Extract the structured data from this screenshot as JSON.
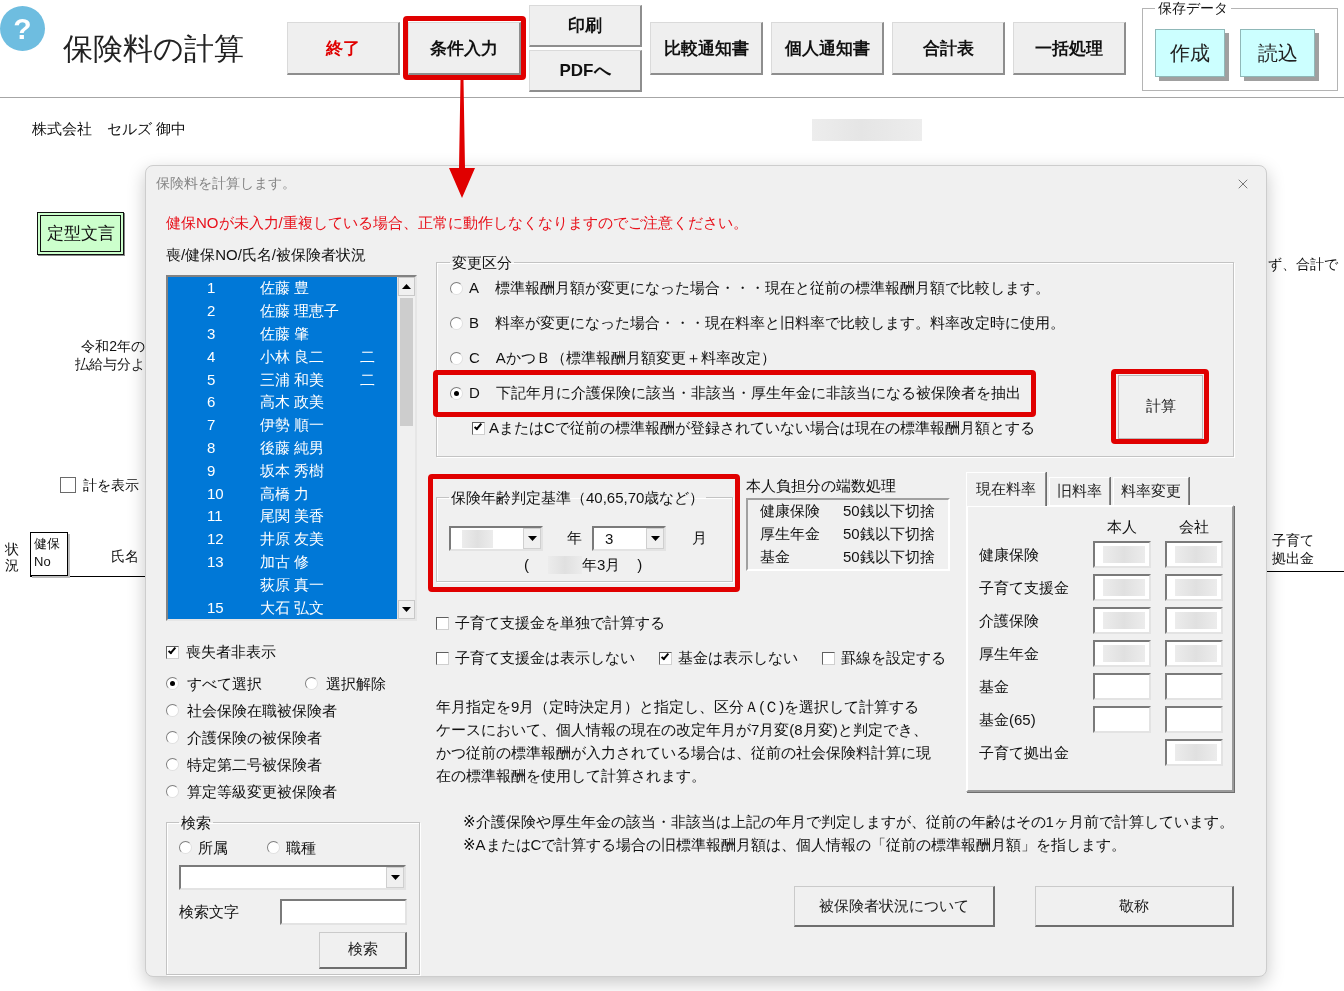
{
  "toolbar": {
    "help": "?",
    "title": "保険料の計算",
    "items": [
      {
        "kind": "exit",
        "label": "終了",
        "highlighted": false
      },
      {
        "kind": "command",
        "label": "条件入力",
        "highlighted": true
      },
      {
        "kind": "stack",
        "buttons": [
          {
            "label": "印刷"
          },
          {
            "label": "PDFへ"
          }
        ]
      },
      {
        "kind": "command",
        "label": "比較通知書",
        "highlighted": false
      },
      {
        "kind": "command",
        "label": "個人通知書",
        "highlighted": false
      },
      {
        "kind": "command",
        "label": "合計表",
        "highlighted": false
      },
      {
        "kind": "command",
        "label": "一括処理",
        "highlighted": false
      }
    ],
    "save_data": {
      "title": "保存データ",
      "buttons": [
        "作成",
        "読込"
      ]
    }
  },
  "sheet": {
    "addressee": "株式会社　セルズ 御中",
    "template_button": "定型文言",
    "memo_lines": [
      "令和2年の",
      "払給与分よ"
    ],
    "show_total": {
      "label": "計を表示",
      "checked": false
    },
    "header": {
      "status": "状況",
      "number": "健保No",
      "name": "氏名"
    },
    "right_text": "ず、合計で",
    "right_header": "子育て拠出金"
  },
  "dialog": {
    "title": "保険料を計算します。",
    "warning": "健保NOが未入力/重複している場合、正常に動作しなくなりますのでご注意ください。",
    "list_label": "喪/健保NO/氏名/被保険者状況",
    "insured_list": [
      {
        "number": "1",
        "name": "佐藤 豊",
        "selected": true
      },
      {
        "number": "2",
        "name": "佐藤 理恵子",
        "selected": true
      },
      {
        "number": "3",
        "name": "佐藤 肇",
        "selected": true
      },
      {
        "number": "4",
        "name": "小林 良二",
        "status": "二",
        "selected": true
      },
      {
        "number": "5",
        "name": "三浦 和美",
        "status": "二",
        "selected": true
      },
      {
        "number": "6",
        "name": "高木 政美",
        "selected": true
      },
      {
        "number": "7",
        "name": "伊勢 順一",
        "selected": true
      },
      {
        "number": "8",
        "name": "後藤 純男",
        "selected": true
      },
      {
        "number": "9",
        "name": "坂本 秀樹",
        "selected": true
      },
      {
        "number": "10",
        "name": "高橋 力",
        "selected": true
      },
      {
        "number": "11",
        "name": "尾関 美香",
        "selected": true
      },
      {
        "number": "12",
        "name": "井原 友美",
        "selected": true
      },
      {
        "number": "13",
        "name": "加古 修",
        "selected": true
      },
      {
        "name": "荻原 真一",
        "selected": true
      },
      {
        "number": "15",
        "name": "大石 弘文",
        "selected": true
      }
    ],
    "hide_lost": {
      "label": "喪失者非表示",
      "checked": true
    },
    "filters": [
      {
        "label": "すべて選択",
        "selected": true
      },
      {
        "label": "選択解除",
        "selected": false
      },
      {
        "label": "社会保険在職被保険者",
        "selected": false
      },
      {
        "label": "介護保険の被保険者",
        "selected": false
      },
      {
        "label": "特定第二号被保険者",
        "selected": false
      },
      {
        "label": "算定等級変更被保険者",
        "selected": false
      }
    ],
    "search": {
      "title": "検索",
      "scopes": [
        {
          "label": "所属",
          "selected": false
        },
        {
          "label": "職種",
          "selected": false
        }
      ],
      "keyword_label": "検索文字",
      "button": "検索"
    },
    "change_type": {
      "title": "変更区分",
      "options": [
        {
          "letter": "A",
          "text": "標準報酬月額が変更になった場合・・・現在と従前の標準報酬月額で比較します。",
          "selected": false,
          "highlighted": false
        },
        {
          "letter": "B",
          "text": "料率が変更になった場合・・・現在料率と旧料率で比較します。料率改定時に使用。",
          "selected": false,
          "highlighted": false
        },
        {
          "letter": "C",
          "text": "AかつＢ（標準報酬月額変更＋料率改定）",
          "selected": false,
          "highlighted": false
        },
        {
          "letter": "D",
          "text": "下記年月に介護保険に該当・非該当・厚生年金に非該当になる被保険者を抽出",
          "selected": true,
          "highlighted": true
        }
      ],
      "fallback": {
        "label": "AまたはCで従前の標準報酬が登録されていない場合は現在の標準報酬月額とする",
        "checked": true
      },
      "calculate": {
        "label": "計算",
        "highlighted": true
      }
    },
    "age_basis": {
      "title": "保険年齢判定基準（40,65,70歳など）",
      "highlighted": true,
      "year": {
        "obscured": true
      },
      "year_unit": "年",
      "month": {
        "value": "3"
      },
      "month_unit": "月",
      "preview": {
        "open": "(",
        "obscured": true,
        "text": "年3月",
        "close": ")"
      }
    },
    "rounding": {
      "title": "本人負担分の端数処理",
      "rows": [
        {
          "label": "健康保険",
          "value": "50銭以下切捨"
        },
        {
          "label": "厚生年金",
          "value": "50銭以下切捨"
        },
        {
          "label": "基金",
          "value": "50銭以下切捨"
        }
      ]
    },
    "option_rows": [
      [
        {
          "label": "子育て支援金を単独で計算する",
          "checked": false
        }
      ],
      [
        {
          "label": "子育て支援金は表示しない",
          "checked": false
        },
        {
          "label": "基金は表示しない",
          "checked": true
        },
        {
          "label": "罫線を設定する",
          "checked": false
        }
      ]
    ],
    "explanation": [
      "年月指定を9月（定時決定月）と指定し、区分Ａ(Ｃ)を選択して計算する",
      "ケースにおいて、個人情報の現在の改定年月が7月変(8月変)と判定でき、",
      "かつ従前の標準報酬が入力されている場合は、従前の社会保険料計算に現",
      "在の標準報酬を使用して計算されます。"
    ],
    "rate_tabs": [
      {
        "label": "現在料率",
        "selected": true
      },
      {
        "label": "旧料率",
        "selected": false
      },
      {
        "label": "料率変更",
        "selected": false
      }
    ],
    "rates": {
      "columns": [
        "本人",
        "会社"
      ],
      "rows": [
        {
          "label": "健康保険",
          "person": {
            "obscured": true
          },
          "company": {
            "obscured": true
          }
        },
        {
          "label": "子育て支援金",
          "person": {
            "obscured": true
          },
          "company": {
            "obscured": true
          }
        },
        {
          "label": "介護保険",
          "person": {
            "obscured": true
          },
          "company": {
            "obscured": true
          }
        },
        {
          "label": "厚生年金",
          "person": {
            "obscured": true
          },
          "company": {
            "obscured": true
          }
        },
        {
          "label": "基金",
          "person": {
            "obscured": false
          },
          "company": {
            "obscured": false
          }
        },
        {
          "label": "基金(65)",
          "person": {
            "obscured": false
          },
          "company": {
            "obscured": false
          }
        },
        {
          "label": "子育て拠出金",
          "company": {
            "obscured": true
          }
        }
      ]
    },
    "notes": [
      "※介護保険や厚生年金の該当・非該当は上記の年月で判定しますが、従前の年齢はその1ヶ月前で計算しています。",
      "※AまたはCで計算する場合の旧標準報酬月額は、個人情報の「従前の標準報酬月額」を指します。"
    ],
    "buttons": [
      "被保険者状況について",
      "敬称"
    ]
  }
}
